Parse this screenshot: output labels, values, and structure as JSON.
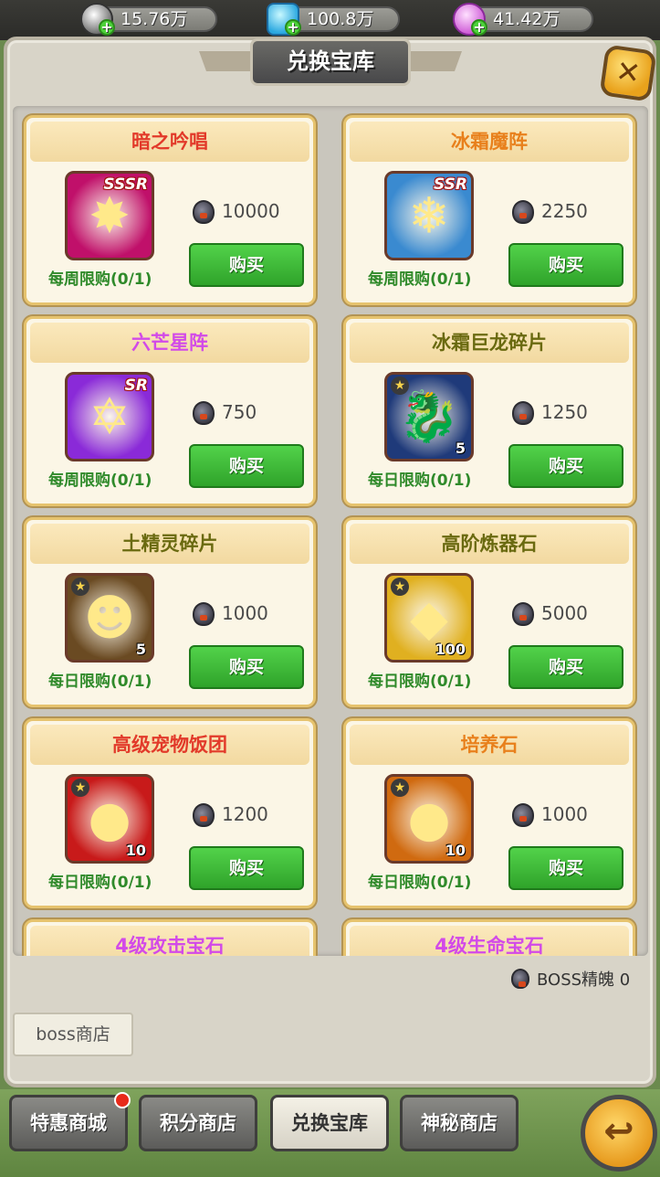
{
  "resources": [
    {
      "icon": "soccer-ball-icon",
      "value": "15.76万"
    },
    {
      "icon": "diamond-icon",
      "value": "100.8万"
    },
    {
      "icon": "shell-icon",
      "value": "41.42万"
    }
  ],
  "title": "兑换宝库",
  "buy_label": "购买",
  "items": [
    {
      "name": "暗之吟唱",
      "name_color": "#e23a2a",
      "rarity": "SSSR",
      "count": "",
      "price": "10000",
      "limit": "每周限购(0/1)",
      "icon_bg": "#c0106a",
      "icon_glyph": "✸"
    },
    {
      "name": "冰霜魔阵",
      "name_color": "#e8801c",
      "rarity": "SSR",
      "count": "",
      "price": "2250",
      "limit": "每周限购(0/1)",
      "icon_bg": "#3a8ad0",
      "icon_glyph": "❄"
    },
    {
      "name": "六芒星阵",
      "name_color": "#d24ae8",
      "rarity": "SR",
      "count": "",
      "price": "750",
      "limit": "每周限购(0/1)",
      "icon_bg": "#8a2ad8",
      "icon_glyph": "✡"
    },
    {
      "name": "冰霜巨龙碎片",
      "name_color": "#6a6a10",
      "rarity": "",
      "count": "5",
      "price": "1250",
      "limit": "每日限购(0/1)",
      "icon_bg": "#1f3a7a",
      "icon_glyph": "🐉"
    },
    {
      "name": "土精灵碎片",
      "name_color": "#6a6a10",
      "rarity": "",
      "count": "5",
      "price": "1000",
      "limit": "每日限购(0/1)",
      "icon_bg": "#6a4a22",
      "icon_glyph": "☻"
    },
    {
      "name": "高阶炼器石",
      "name_color": "#6a6a10",
      "rarity": "",
      "count": "100",
      "price": "5000",
      "limit": "每日限购(0/1)",
      "icon_bg": "#e0b020",
      "icon_glyph": "◆"
    },
    {
      "name": "高级宠物饭团",
      "name_color": "#e23a2a",
      "rarity": "",
      "count": "10",
      "price": "1200",
      "limit": "每日限购(0/1)",
      "icon_bg": "#c81a1a",
      "icon_glyph": "●"
    },
    {
      "name": "培养石",
      "name_color": "#e8801c",
      "rarity": "",
      "count": "10",
      "price": "1000",
      "limit": "每日限购(0/1)",
      "icon_bg": "#d06a10",
      "icon_glyph": "●"
    },
    {
      "name": "4级攻击宝石",
      "name_color": "#d24ae8",
      "rarity": "",
      "count": "",
      "price": "",
      "limit": "",
      "icon_bg": "",
      "icon_glyph": ""
    },
    {
      "name": "4级生命宝石",
      "name_color": "#d24ae8",
      "rarity": "",
      "count": "",
      "price": "",
      "limit": "",
      "icon_bg": "",
      "icon_glyph": ""
    }
  ],
  "boss_currency": {
    "label": "BOSS精魄 0"
  },
  "boss_shop_button": "boss商店",
  "tabs": [
    {
      "label": "特惠商城",
      "active": false,
      "badge": true
    },
    {
      "label": "积分商店",
      "active": false,
      "badge": false
    },
    {
      "label": "兑换宝库",
      "active": true,
      "badge": false
    },
    {
      "label": "神秘商店",
      "active": false,
      "badge": false
    }
  ],
  "back_button": {
    "icon": "back-arrow-icon"
  },
  "close_button": {
    "icon": "close-icon"
  }
}
